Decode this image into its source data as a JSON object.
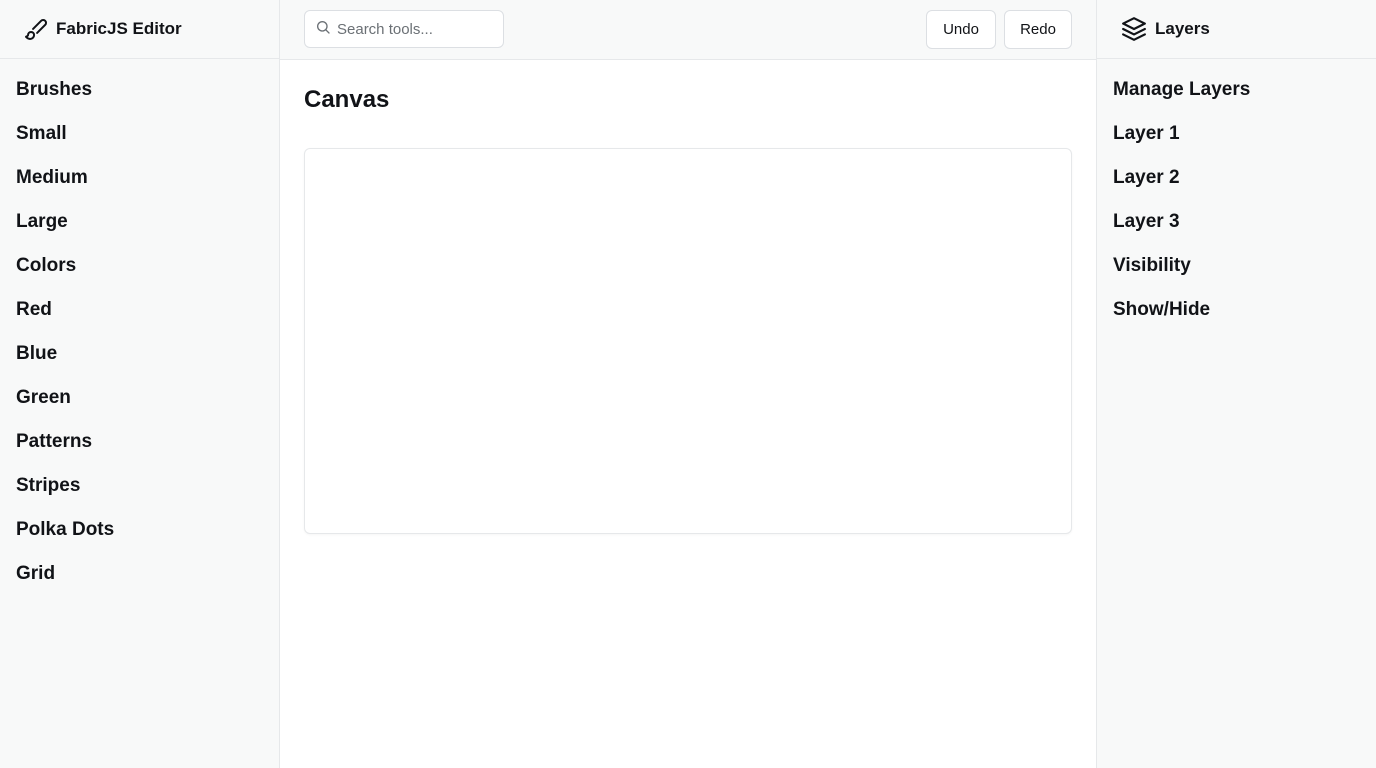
{
  "app": {
    "title": "FabricJS Editor"
  },
  "left_nav": {
    "items": [
      {
        "label": "Brushes"
      },
      {
        "label": "Small"
      },
      {
        "label": "Medium"
      },
      {
        "label": "Large"
      },
      {
        "label": "Colors"
      },
      {
        "label": "Red"
      },
      {
        "label": "Blue"
      },
      {
        "label": "Green"
      },
      {
        "label": "Patterns"
      },
      {
        "label": "Stripes"
      },
      {
        "label": "Polka Dots"
      },
      {
        "label": "Grid"
      }
    ]
  },
  "toolbar": {
    "search_placeholder": "Search tools...",
    "search_value": "",
    "undo_label": "Undo",
    "redo_label": "Redo"
  },
  "main": {
    "title": "Canvas"
  },
  "right_panel": {
    "title": "Layers",
    "items": [
      {
        "label": "Manage Layers"
      },
      {
        "label": "Layer 1"
      },
      {
        "label": "Layer 2"
      },
      {
        "label": "Layer 3"
      },
      {
        "label": "Visibility"
      },
      {
        "label": "Show/Hide"
      }
    ]
  },
  "icons": {
    "brand": "brush-icon",
    "search": "search-icon",
    "layers": "layers-icon"
  }
}
